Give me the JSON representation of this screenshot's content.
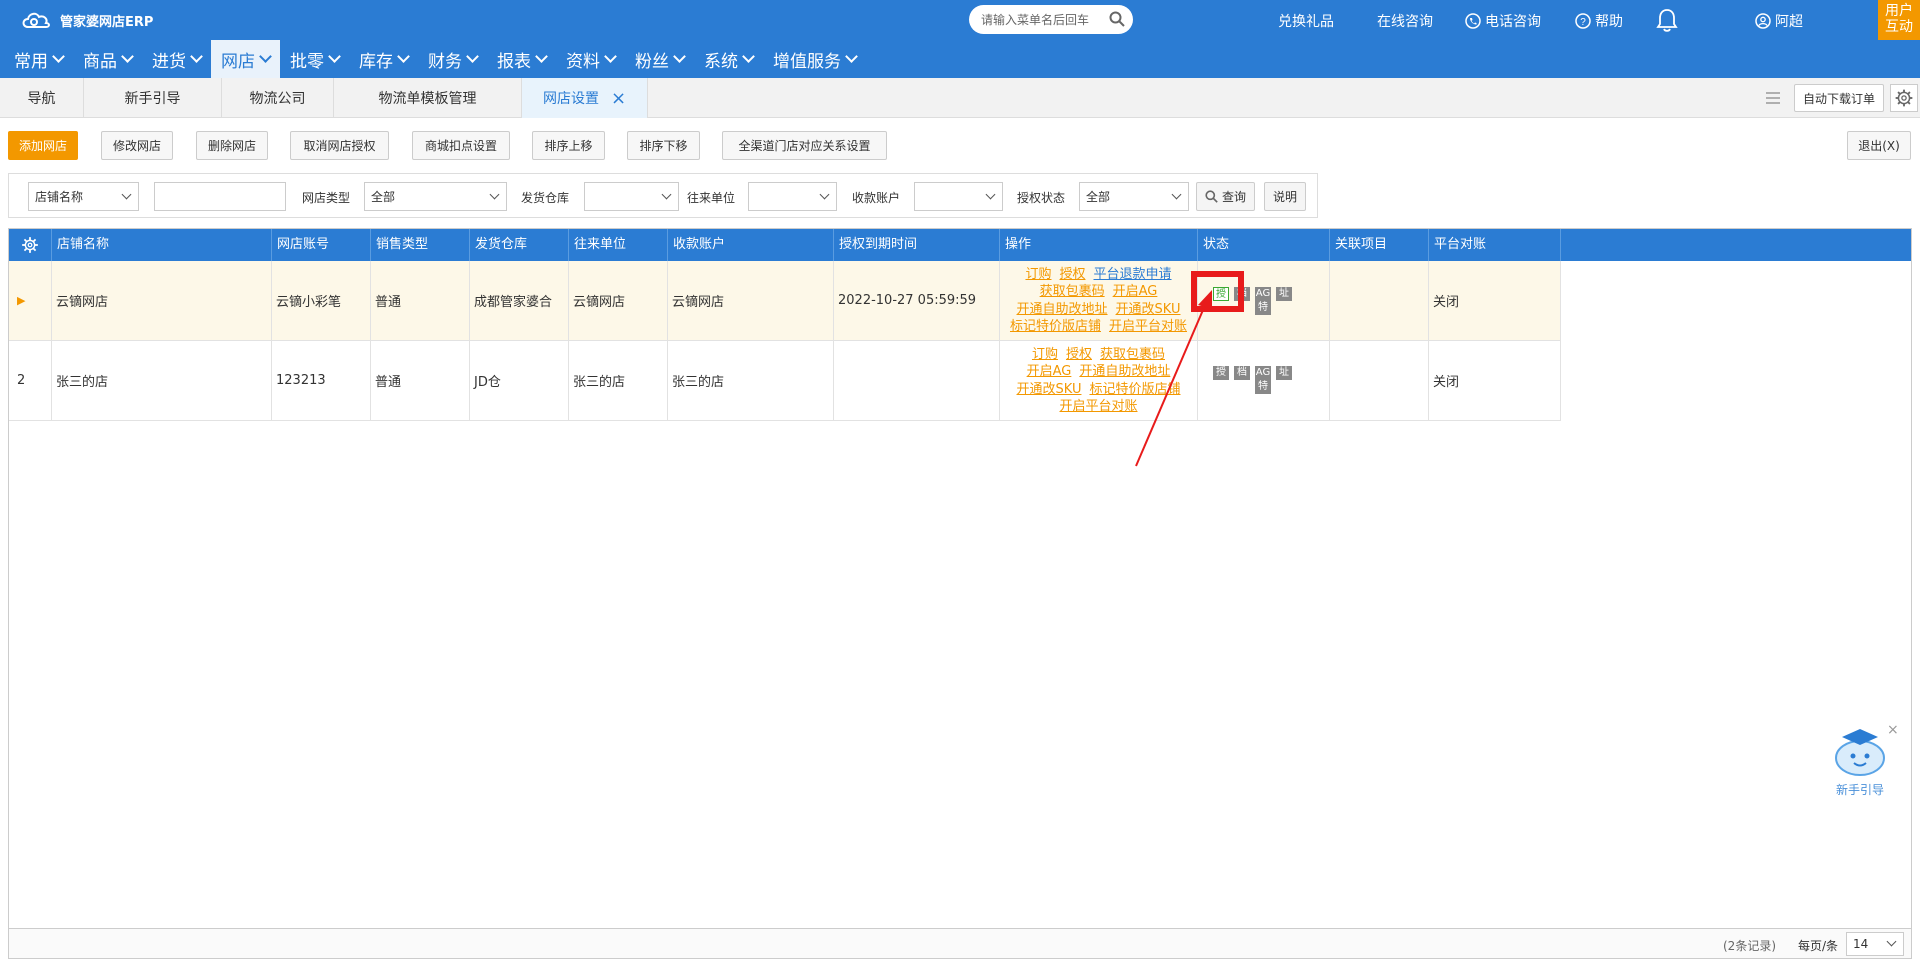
{
  "header": {
    "app_name": "管家婆网店ERP",
    "search_placeholder": "请输入菜单名后回车",
    "links": {
      "gift": "兑换礼品",
      "online": "在线咨询",
      "phone": "电话咨询",
      "help": "帮助",
      "user": "阿超"
    },
    "corner_badge": [
      "用户",
      "互动"
    ]
  },
  "nav": [
    "常用",
    "商品",
    "进货",
    "网店",
    "批零",
    "库存",
    "财务",
    "报表",
    "资料",
    "粉丝",
    "系统",
    "增值服务"
  ],
  "nav_active": "网店",
  "tabs": [
    "导航",
    "新手引导",
    "物流公司",
    "物流单模板管理",
    "网店设置"
  ],
  "tabs_active": "网店设置",
  "tabs_right": {
    "auto_download": "自动下载订单"
  },
  "toolbar": {
    "buttons": [
      "添加网店",
      "修改网店",
      "删除网店",
      "取消网店授权",
      "商城扣点设置",
      "排序上移",
      "排序下移",
      "全渠道门店对应关系设置"
    ],
    "exit": "退出(X)"
  },
  "filter": {
    "field_select": "店铺名称",
    "field_value": "",
    "shop_type_label": "网店类型",
    "shop_type_value": "全部",
    "warehouse_label": "发货仓库",
    "warehouse_value": "",
    "partner_label": "往来单位",
    "partner_value": "",
    "account_label": "收款账户",
    "account_value": "",
    "auth_label": "授权状态",
    "auth_value": "全部",
    "query": "查询",
    "explain": "说明"
  },
  "grid": {
    "columns": [
      "店铺名称",
      "网店账号",
      "销售类型",
      "发货仓库",
      "往来单位",
      "收款账户",
      "授权到期时间",
      "操作",
      "状态",
      "关联项目",
      "平台对账"
    ],
    "rows": [
      {
        "marker": "▶",
        "shop_name": "云镝网店",
        "account": "云镝小彩笔",
        "sale_type": "普通",
        "warehouse": "成都管家婆合",
        "partner": "云镝网店",
        "payee": "云镝网店",
        "auth_expire": "2022-10-27 05:59:59",
        "ops": [
          [
            "订购",
            "授权",
            "平台退款申请"
          ],
          [
            "获取包裹码",
            "开启AG"
          ],
          [
            "开通自助改地址",
            "开通改SKU"
          ],
          [
            "标记特价版店铺",
            "开启平台对账"
          ]
        ],
        "status_tags": [
          "授",
          "档",
          "AG",
          "址",
          "特"
        ],
        "related": "",
        "reconcile": "关闭"
      },
      {
        "marker": "2",
        "shop_name": "张三的店",
        "account": "123213",
        "sale_type": "普通",
        "warehouse": "JD仓",
        "partner": "张三的店",
        "payee": "张三的店",
        "auth_expire": "",
        "ops": [
          [
            "订购",
            "授权",
            "获取包裹码"
          ],
          [
            "开启AG",
            "开通自助改地址"
          ],
          [
            "开通改SKU",
            "标记特价版店铺"
          ],
          [
            "开启平台对账"
          ]
        ],
        "status_tags": [
          "授",
          "档",
          "AG",
          "址",
          "特"
        ],
        "related": "",
        "reconcile": "关闭"
      }
    ],
    "footer": {
      "records": "(2条记录)",
      "per_page_label": "每页/条",
      "per_page_value": "14"
    }
  },
  "helper_label": "新手引导",
  "colors": {
    "brand": "#2b7cd3",
    "accent": "#f39800",
    "annotation": "#e81b1b"
  }
}
